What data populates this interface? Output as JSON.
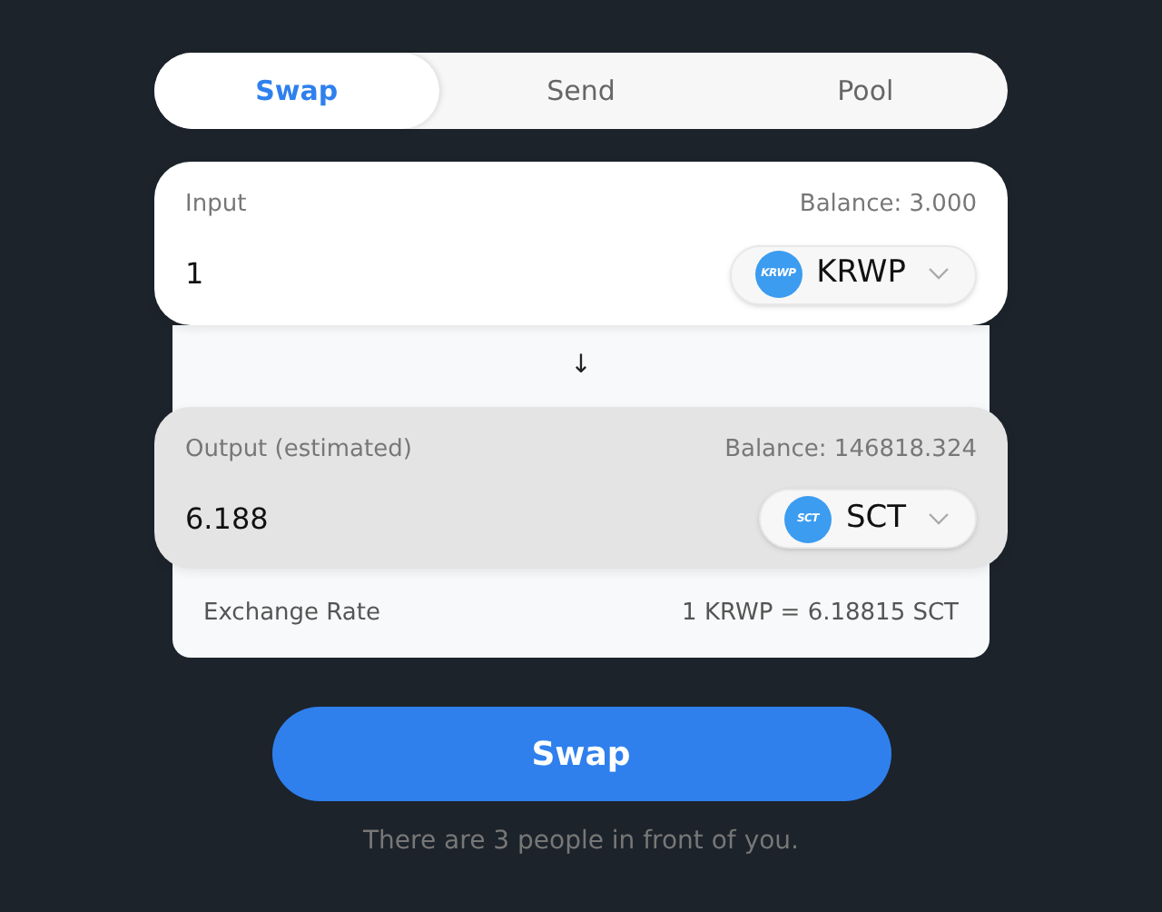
{
  "tabs": [
    {
      "label": "Swap",
      "selected": true
    },
    {
      "label": "Send",
      "selected": false
    },
    {
      "label": "Pool",
      "selected": false
    }
  ],
  "input": {
    "label": "Input",
    "balance": "Balance: 3.000",
    "value": "1",
    "token": {
      "logo": "KRWP",
      "symbol": "KRWP"
    }
  },
  "direction_arrow": "↓",
  "output": {
    "label": "Output (estimated)",
    "balance": "Balance: 146818.324",
    "value": "6.188",
    "token": {
      "logo": "SCT",
      "symbol": "SCT"
    }
  },
  "exchange_rate": {
    "label": "Exchange Rate",
    "value": "1 KRWP = 6.18815 SCT"
  },
  "swap_button": "Swap",
  "queue_note": "There are 3 people in front of you."
}
